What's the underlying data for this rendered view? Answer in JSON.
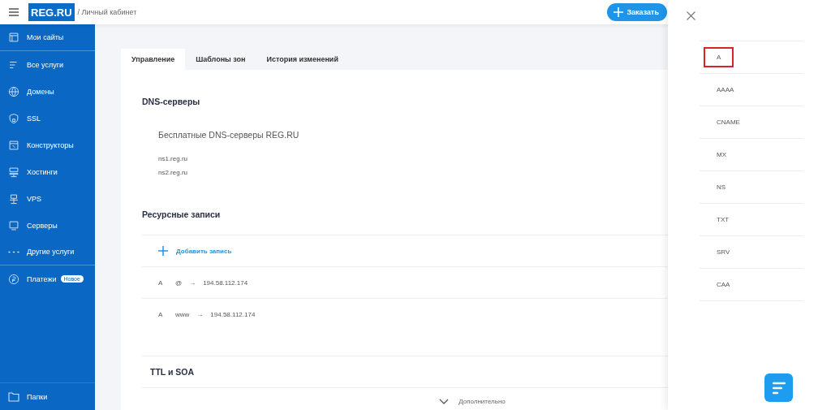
{
  "header": {
    "logo": "REG.RU",
    "breadcrumb": "/ Личный кабинет",
    "order_button": "Заказать"
  },
  "sidebar": {
    "items": [
      {
        "label": "Мои сайты",
        "divider_after": true
      },
      {
        "label": "Все услуги",
        "divider_after": false
      },
      {
        "label": "Домены",
        "divider_after": false
      },
      {
        "label": "SSL",
        "divider_after": false
      },
      {
        "label": "Конструкторы",
        "divider_after": false
      },
      {
        "label": "Хостинги",
        "divider_after": false
      },
      {
        "label": "VPS",
        "divider_after": false
      },
      {
        "label": "Серверы",
        "divider_after": false
      },
      {
        "label": "Другие услуги",
        "divider_after": true
      },
      {
        "label": "Платежи",
        "badge": "Новое",
        "divider_after": false
      }
    ],
    "footer_item": "Папки"
  },
  "tabs": [
    {
      "label": "Управление",
      "selected": true
    },
    {
      "label": "Шаблоны зон",
      "selected": false
    },
    {
      "label": "История изменений",
      "selected": false
    }
  ],
  "dns_servers": {
    "title": "DNS-серверы",
    "subtitle": "Бесплатные DNS-серверы REG.RU",
    "servers": [
      "ns1.reg.ru",
      "ns2.reg.ru"
    ]
  },
  "resource_records": {
    "title": "Ресурсные записи",
    "add_label": "Добавить запись",
    "records": [
      {
        "type": "A",
        "host": "@",
        "arrow": "→",
        "value": "194.58.112.174"
      },
      {
        "type": "A",
        "host": "www",
        "arrow": "→",
        "value": "194.58.112.174"
      }
    ]
  },
  "ttl_soa": {
    "title": "TTL и SOA",
    "more": "Дополнительно"
  },
  "record_types": [
    {
      "label": "A",
      "selected": true
    },
    {
      "label": "AAAA",
      "selected": false
    },
    {
      "label": "CNAME",
      "selected": false
    },
    {
      "label": "MX",
      "selected": false
    },
    {
      "label": "NS",
      "selected": false
    },
    {
      "label": "TXT",
      "selected": false
    },
    {
      "label": "SRV",
      "selected": false
    },
    {
      "label": "CAA",
      "selected": false
    }
  ]
}
